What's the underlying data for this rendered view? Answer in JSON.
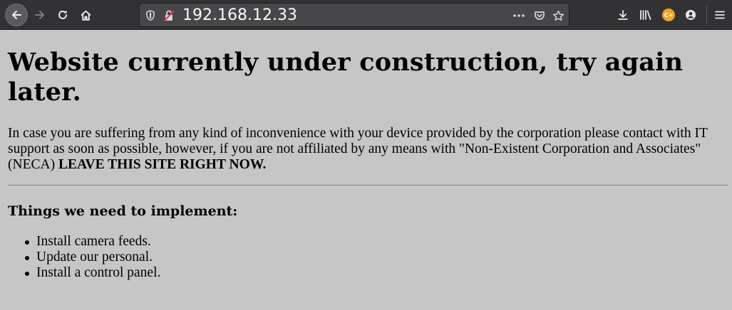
{
  "browser": {
    "url": "192.168.12.33",
    "icons": {
      "back": "arrow-left-icon",
      "forward": "arrow-right-icon",
      "reload": "reload-icon",
      "home": "home-icon",
      "tracking": "shield-icon",
      "insecure": "broken-lock-icon",
      "page_actions": "more-horizontal-icon",
      "pocket": "pocket-icon",
      "bookmark": "star-icon",
      "downloads": "download-icon",
      "library": "library-icon",
      "extension": "cookie-editor-icon",
      "account": "account-icon",
      "menu": "hamburger-menu-icon"
    },
    "extension_badge": "C+",
    "colors": {
      "toolbar": "#323234",
      "urlbar": "#474749",
      "extension": "#f0a22b"
    }
  },
  "page": {
    "heading": "Website currently under construction, try again later.",
    "intro_text": "In case you are suffering from any kind of inconvenience with your device provided by the corporation please contact with IT support as soon as possible, however, if you are not affiliated by any means with \"Non-Existent Corporation and Associates\" (NECA) ",
    "intro_warning": "LEAVE THIS SITE RIGHT NOW.",
    "subheading": "Things we need to implement:",
    "todo_items": [
      "Install camera feeds.",
      "Update our personal.",
      "Install a control panel."
    ],
    "background": "#c6c6c6"
  }
}
